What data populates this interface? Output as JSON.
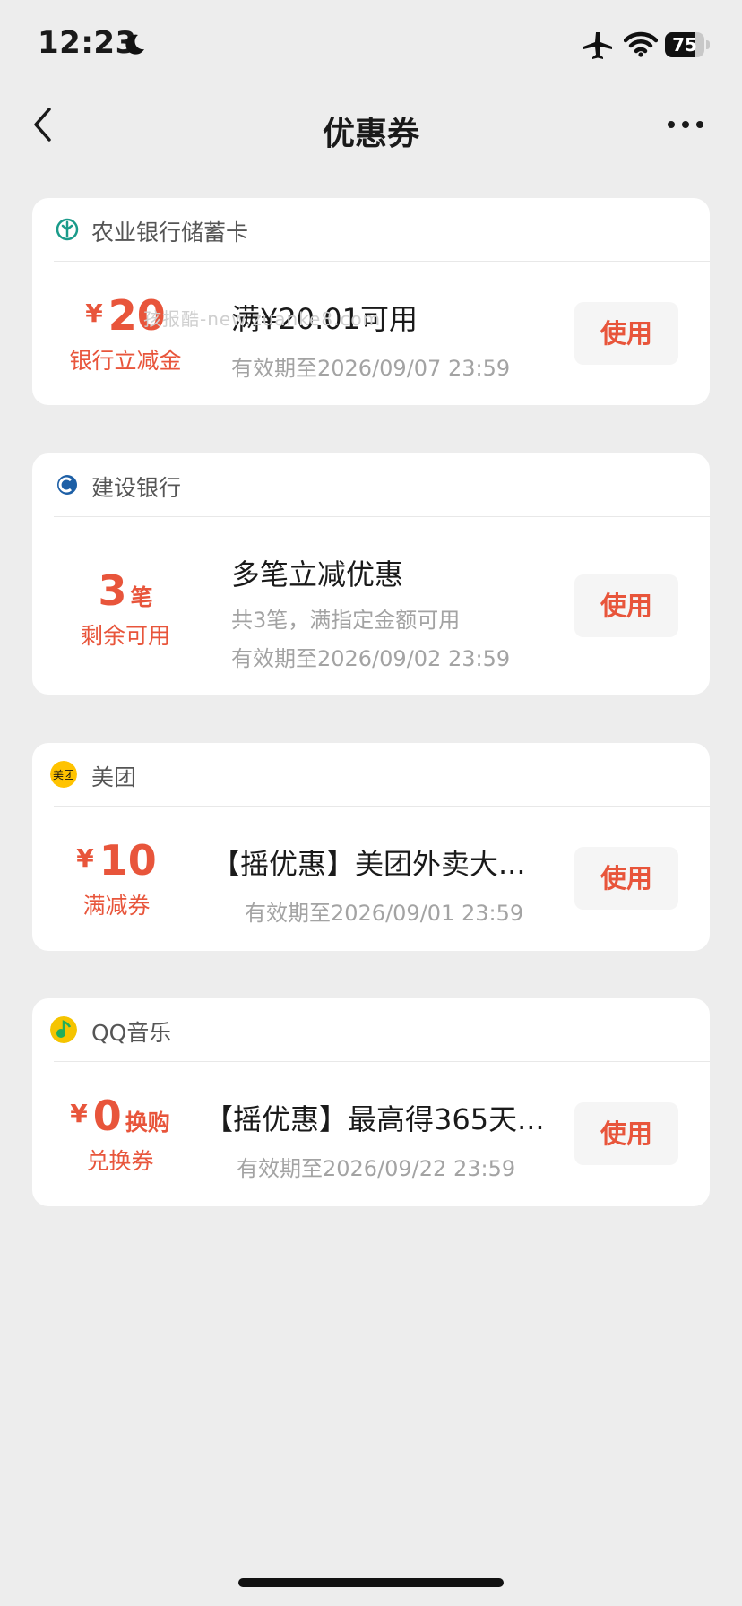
{
  "status_bar": {
    "time": "12:23",
    "battery_level": "75",
    "battery_fraction": 0.75
  },
  "nav": {
    "title": "优惠券"
  },
  "watermark": "孩报酷-new.zuanke8.com",
  "coupons": [
    {
      "merchant": "农业银行储蓄卡",
      "logo_icon": "abc-bank-logo-icon",
      "logo_color": "#1a9b8a",
      "currency": "¥",
      "amount": "20",
      "unit": "",
      "value_label": "银行立减金",
      "title": "满¥20.01可用",
      "desc": "",
      "valid": "有效期至2026/09/07 23:59",
      "button": "使用"
    },
    {
      "merchant": "建设银行",
      "logo_icon": "ccb-bank-logo-icon",
      "logo_color": "#1d5fa6",
      "currency": "",
      "amount": "3",
      "unit": "笔",
      "value_label": "剩余可用",
      "title": "多笔立减优惠",
      "desc": "共3笔，满指定金额可用",
      "valid": "有效期至2026/09/02 23:59",
      "button": "使用"
    },
    {
      "merchant": "美团",
      "logo_icon": "meituan-logo-icon",
      "logo_color": "#ffc300",
      "logo_text": "美团",
      "currency": "¥",
      "amount": "10",
      "unit": "",
      "value_label": "满减券",
      "title": "【摇优惠】美团外卖大...",
      "desc": "",
      "valid": "有效期至2026/09/01 23:59",
      "button": "使用"
    },
    {
      "merchant": "QQ音乐",
      "logo_icon": "qq-music-logo-icon",
      "logo_color": "#f5c400",
      "currency": "¥",
      "amount": "0",
      "unit": "换购",
      "value_label": "兑换券",
      "title": "【摇优惠】最高得365天...",
      "desc": "",
      "valid": "有效期至2026/09/22 23:59",
      "button": "使用"
    }
  ]
}
